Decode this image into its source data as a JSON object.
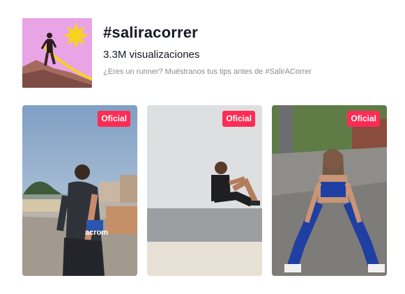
{
  "hashtag": {
    "title": "#saliracorrer",
    "views": "3.3M visualizaciones",
    "description": "¿Eres un runner? Muéstranos tus tips antes de #SalirACorrer",
    "cover_icon": "sun-runner-illustration"
  },
  "videos": [
    {
      "badge": "Oficial",
      "scene": "runner-on-promenade",
      "jersey_text": "acrom"
    },
    {
      "badge": "Oficial",
      "scene": "man-sitting-against-wall"
    },
    {
      "badge": "Oficial",
      "scene": "woman-stretching-on-street"
    }
  ],
  "colors": {
    "badge": "#fe2c55",
    "text_primary": "#161823",
    "text_secondary": "#8a8b91",
    "cover_bg": "#e9a4e6",
    "cover_sun": "#f7d31d"
  }
}
